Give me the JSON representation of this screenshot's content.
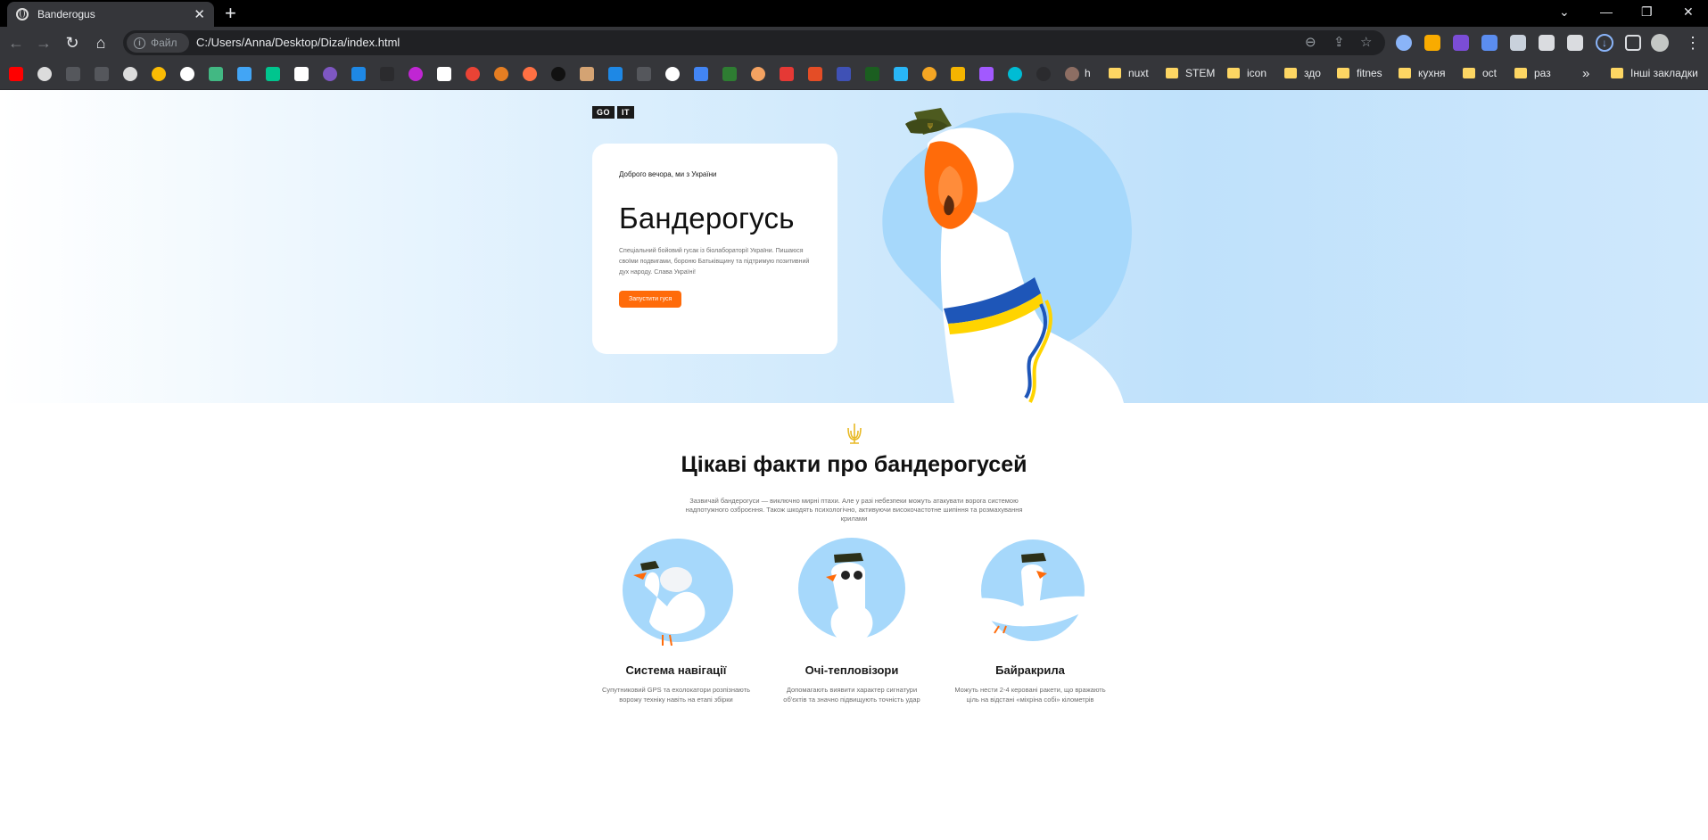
{
  "browser": {
    "tab_title": "Banderogus",
    "tab_close": "✕",
    "new_tab": "+",
    "window_controls": {
      "tab_search": "⌄",
      "minimize": "—",
      "restore": "❐",
      "close": "✕"
    },
    "nav": {
      "back": "←",
      "forward": "→",
      "reload": "↻",
      "home": "⌂"
    },
    "address": {
      "chip_label": "Файл",
      "url": "C:/Users/Anna/Desktop/Diza/index.html"
    },
    "omnibox_icons": {
      "zoom": "⊖",
      "share": "⇪",
      "star": "☆"
    },
    "bookmark_folders": [
      "nuxt",
      "STEM",
      "icon",
      "здо",
      "fitnes",
      "кухня",
      "oct",
      "раз"
    ],
    "bookmark_h_label": "h",
    "bookmarks_more": "»",
    "other_bookmarks": "Інші закладки",
    "accent": "#8ab4f8"
  },
  "hero": {
    "logo_left": "GO",
    "logo_right": "IT",
    "subtitle": "Доброго вечора, ми з України",
    "title": "Бандерогусь",
    "text": "Спеціальний бойовий гусак із біолабораторії України. Пишаюся своїми подвигами, бороню Батьківщину та підтримую позитивний дух народу. Слава Україні!",
    "button_label": "Запустити гуся",
    "accent": "#ff6b0a"
  },
  "facts": {
    "title": "Цікаві факти про бандерогусей",
    "text": "Зазвичай бандерогуси — виключно мирні птахи. Але у разі небезпеки можуть атакувати ворога системою надпотужного озброєння. Також шкодять психологічно, активуючи високочастотне шипіння та розмахування крилами",
    "items": [
      {
        "title": "Система навігації",
        "text": "Супутниковий GPS та ехолокатори розпізнають ворожу техніку навіть на етапі збірки"
      },
      {
        "title": "Очі-тепловізори",
        "text": "Допомагають виявити характер сигнатури об'єктів та значно підвищують точність удар"
      },
      {
        "title": "Байракрила",
        "text": "Можуть нести 2-4 керовані ракети, що вражають ціль на відстані «міхріна собі» кілометрів"
      }
    ]
  }
}
